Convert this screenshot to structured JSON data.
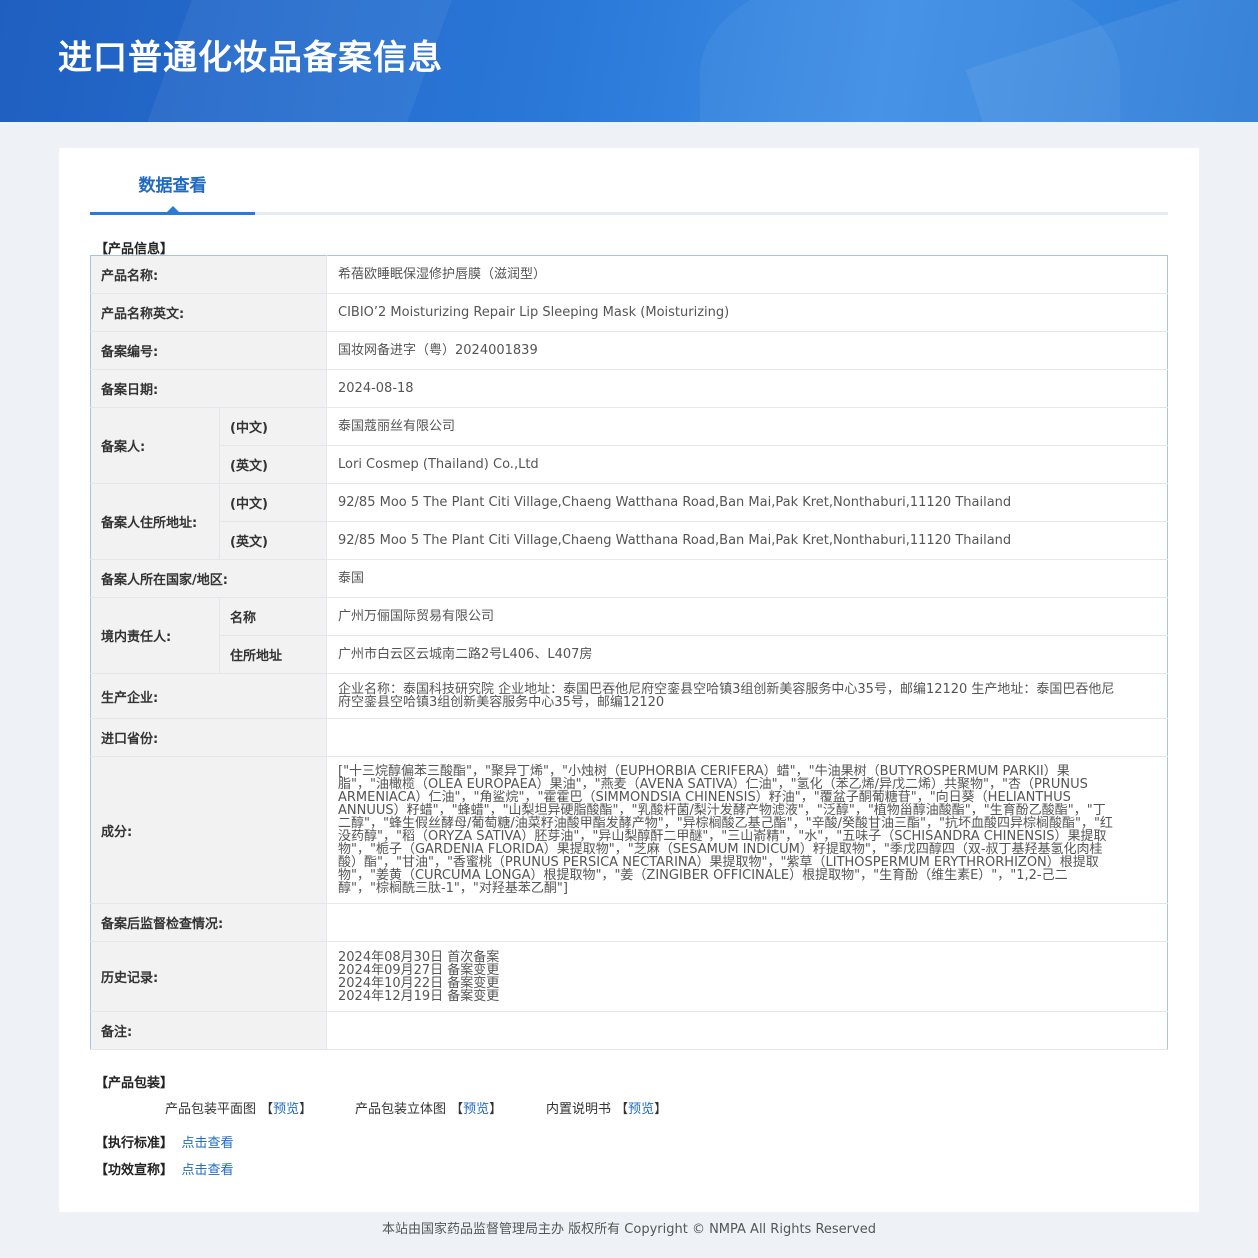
{
  "header": {
    "title": "进口普通化妆品备案信息"
  },
  "tab": {
    "label": "数据查看"
  },
  "sections": {
    "product_info": "【产品信息】",
    "packaging": "【产品包装】",
    "standard": "【执行标准】",
    "efficacy": "【功效宣称】"
  },
  "rows": {
    "name_cn": {
      "label": "产品名称:",
      "value": "希蓓欧睡眠保湿修护唇膜（滋润型）"
    },
    "name_en": {
      "label": "产品名称英文:",
      "value": "CIBIO’2 Moisturizing Repair Lip Sleeping Mask (Moisturizing)"
    },
    "reg_no": {
      "label": "备案编号:",
      "value": "国妆网备进字（粤）2024001839"
    },
    "reg_date": {
      "label": "备案日期:",
      "value": "2024-08-18"
    },
    "applicant": {
      "label": "备案人:",
      "cn_label": "(中文)",
      "cn_value": "泰国蔻丽丝有限公司",
      "en_label": "(英文)",
      "en_value": "Lori Cosmep (Thailand) Co.,Ltd"
    },
    "address": {
      "label": "备案人住所地址:",
      "cn_label": "(中文)",
      "cn_value": "92/85 Moo 5 The Plant Citi Village,Chaeng Watthana Road,Ban Mai,Pak Kret,Nonthaburi,11120 Thailand",
      "en_label": "(英文)",
      "en_value": "92/85 Moo 5 The Plant Citi Village,Chaeng Watthana Road,Ban Mai,Pak Kret,Nonthaburi,11120 Thailand"
    },
    "country": {
      "label": "备案人所在国家/地区:",
      "value": "泰国"
    },
    "domestic": {
      "label": "境内责任人:",
      "name_label": "名称",
      "name_value": "广州万俪国际贸易有限公司",
      "addr_label": "住所地址",
      "addr_value": "广州市白云区云城南二路2号L406、L407房"
    },
    "manufacturer": {
      "label": "生产企业:",
      "value": "企业名称：泰国科技研究院 企业地址：泰国巴吞他尼府空銮县空哈镇3组创新美容服务中心35号，邮编12120 生产地址：泰国巴吞他尼府空銮县空哈镇3组创新美容服务中心35号，邮编12120"
    },
    "import_province": {
      "label": "进口省份:",
      "value": ""
    },
    "ingredients": {
      "label": "成分:",
      "value": "[\"十三烷醇偏苯三酸酯\"，\"聚异丁烯\"，\"小烛树（EUPHORBIA CERIFERA）蜡\"，\"牛油果树（BUTYROSPERMUM PARKII）果脂\"，\"油橄榄（OLEA EUROPAEA）果油\"，\"燕麦（AVENA SATIVA）仁油\"，\"氢化（苯乙烯/异戊二烯）共聚物\"，\"杏（PRUNUS ARMENIACA）仁油\"，\"角鲨烷\"，\"霍霍巴（SIMMONDSIA CHINENSIS）籽油\"，\"覆盆子酮葡糖苷\"，\"向日葵（HELIANTHUS ANNUUS）籽蜡\"，\"蜂蜡\"，\"山梨坦异硬脂酸酯\"，\"乳酸杆菌/梨汁发酵产物滤液\"，\"泛醇\"，\"植物甾醇油酸酯\"，\"生育酚乙酸酯\"，\"丁二醇\"，\"蜂生假丝酵母/葡萄糖/油菜籽油酸甲酯发酵产物\"，\"异棕榈酸乙基己酯\"，\"辛酸/癸酸甘油三酯\"，\"抗坏血酸四异棕榈酸酯\"，\"红没药醇\"，\"稻（ORYZA SATIVA）胚芽油\"，\"异山梨醇酐二甲醚\"，\"三山嵛精\"，\"水\"，\"五味子（SCHISANDRA CHINENSIS）果提取物\"，\"栀子（GARDENIA FLORIDA）果提取物\"，\"芝麻（SESAMUM INDICUM）籽提取物\"，\"季戊四醇四（双-叔丁基羟基氢化肉桂酸）酯\"，\"甘油\"，\"香蜜桃（PRUNUS PERSICA NECTARINA）果提取物\"，\"紫草（LITHOSPERMUM ERYTHRORHIZON）根提取物\"，\"姜黄（CURCUMA LONGA）根提取物\"，\"姜（ZINGIBER OFFICINALE）根提取物\"，\"生育酚（维生素E）\"，\"1,2-己二醇\"，\"棕榈酰三肽-1\"，\"对羟基苯乙酮\"]"
    },
    "supervision": {
      "label": "备案后监督检查情况:",
      "value": ""
    },
    "history": {
      "label": "历史记录:",
      "items": [
        "2024年08月30日 首次备案",
        "2024年09月27日 备案变更",
        "2024年10月22日 备案变更",
        "2024年12月19日 备案变更"
      ]
    },
    "remark": {
      "label": "备注:",
      "value": ""
    }
  },
  "packaging": {
    "flat": {
      "label": "产品包装平面图 【",
      "link": "预览",
      "end": "】"
    },
    "three_d": {
      "label": "产品包装立体图 【",
      "link": "预览",
      "end": "】"
    },
    "manual": {
      "label": "内置说明书 【",
      "link": "预览",
      "end": "】"
    }
  },
  "standard_link": "点击查看",
  "efficacy_link": "点击查看",
  "footer": "本站由国家药品监督管理局主办 版权所有 Copyright © NMPA All Rights Reserved"
}
